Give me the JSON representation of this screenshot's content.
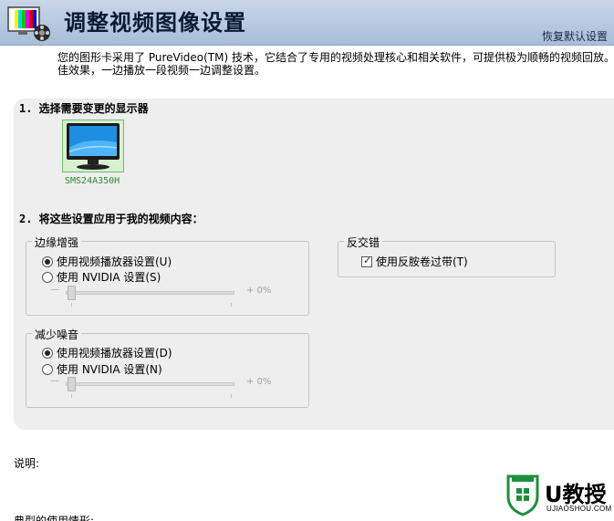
{
  "header": {
    "title": "调整视频图像设置",
    "restore_link": "恢复默认设置"
  },
  "description": {
    "line1": "您的图形卡采用了 PureVideo(TM) 技术，它结合了专用的视频处理核心和相关软件，可提供极为顺畅的视频回放。次",
    "line2": "佳效果，一边播放一段视频一边调整设置。"
  },
  "step1": {
    "title": "1. 选择需要变更的显示器",
    "monitor_label": "SMS24A350H"
  },
  "step2": {
    "title": "2. 将这些设置应用于我的视频内容："
  },
  "edge_enhancement": {
    "title": "边缘增强",
    "option1": "使用视频播放器设置(U)",
    "option2": "使用 NVIDIA 设置(S)",
    "selected": 1,
    "slider_minus": "—",
    "slider_value": "+ 0%"
  },
  "noise_reduction": {
    "title": "减少噪音",
    "option1": "使用视频播放器设置(D)",
    "option2": "使用 NVIDIA 设置(N)",
    "selected": 1,
    "slider_minus": "—",
    "slider_value": "+ 0%"
  },
  "deinterlacing": {
    "title": "反交错",
    "checkbox_label": "使用反胺卷过带(T)",
    "checked": true
  },
  "explanation_label": "说明:",
  "typical_usage_label": "典型的使用情形:",
  "watermark": {
    "brand": "U教授",
    "url": "UJIAOSHOU.COM"
  },
  "colors": {
    "header_bg": "#b5c6dd",
    "panel_bg": "#eeeeee",
    "monitor_label": "#2c8c2c"
  }
}
